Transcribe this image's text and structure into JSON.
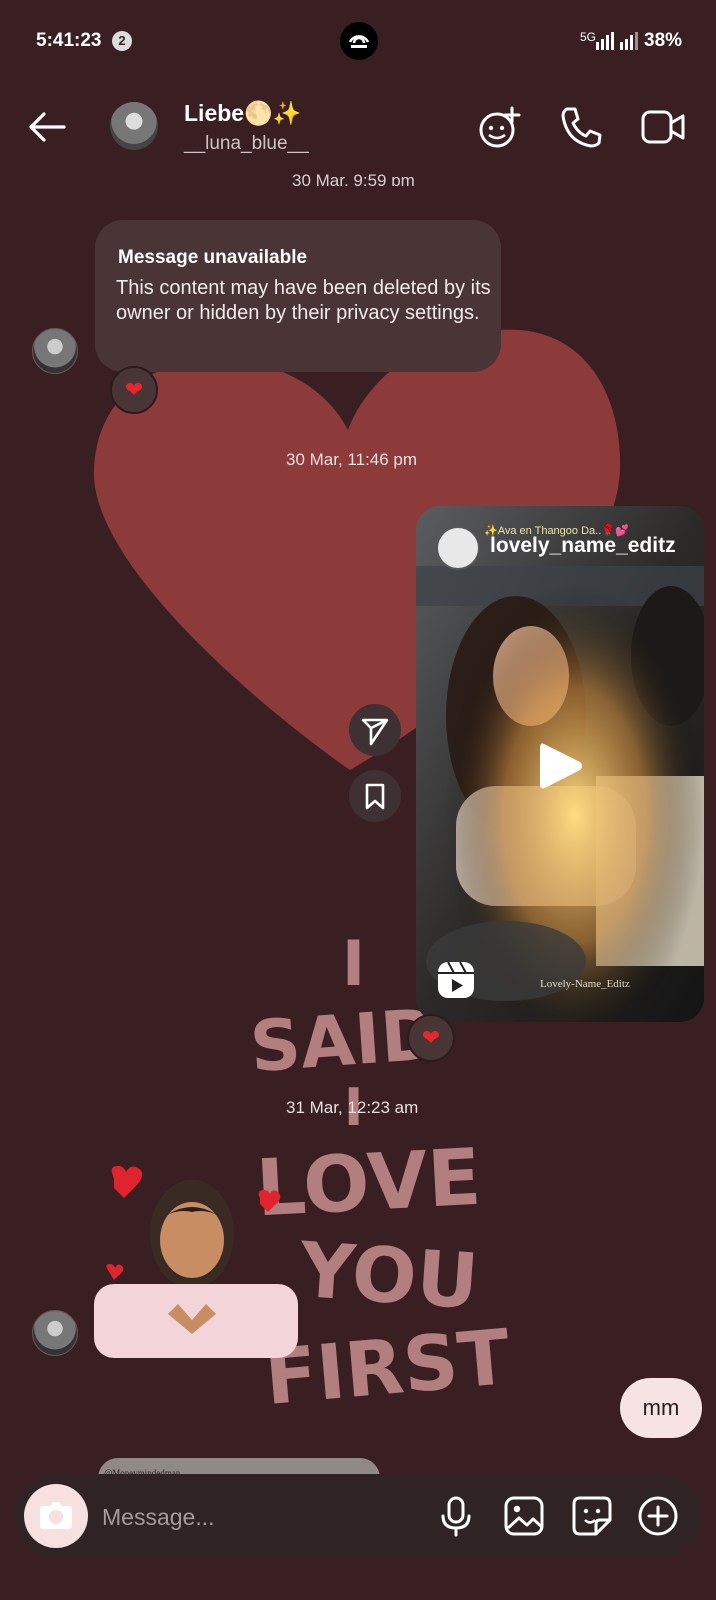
{
  "status_bar": {
    "time": "5:41:23",
    "notification_count": "2",
    "network": "5G",
    "battery": "38%"
  },
  "header": {
    "name": "Liebe🌕✨",
    "username": "__luna_blue__"
  },
  "thread": {
    "date_cut": "30 Mar, 9:59 pm",
    "unavailable_title": "Message unavailable",
    "unavailable_body": "This content may have been deleted by its owner or hidden by their privacy settings.",
    "timestamp_1": "30 Mar, 11:46 pm",
    "reel_user": "lovely_name_editz",
    "reel_header_text": "✨Ava en Thangoo Da..🌹💕",
    "reel_footer_text": "Lovely-Name_Editz",
    "timestamp_2": "31 Mar, 12:23 am",
    "sent_message": "mm",
    "peek_text": "@Moneymindedman"
  },
  "background_text": [
    "I",
    "SAID",
    "I",
    "LOVE",
    "YOU",
    "FIRST"
  ],
  "composer": {
    "placeholder": "Message..."
  },
  "colors": {
    "background": "#3a1f22",
    "heart": "#8d3a3a",
    "outgoing_bubble": "#f7e3e3",
    "reaction_heart": "#e4262d"
  }
}
